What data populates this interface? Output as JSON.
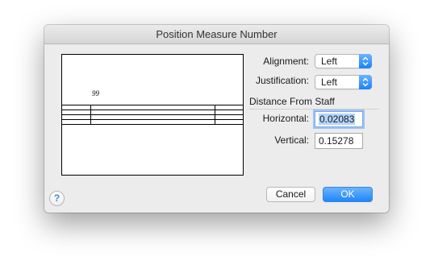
{
  "dialog": {
    "title": "Position Measure Number"
  },
  "preview": {
    "measure_number": "99"
  },
  "alignment": {
    "label": "Alignment:",
    "value": "Left"
  },
  "justification": {
    "label": "Justification:",
    "value": "Left"
  },
  "distance": {
    "section_label": "Distance From Staff",
    "horizontal_label": "Horizontal:",
    "horizontal_value": "0.02083",
    "vertical_label": "Vertical:",
    "vertical_value": "0.15278"
  },
  "buttons": {
    "help": "?",
    "cancel": "Cancel",
    "ok": "OK"
  },
  "colors": {
    "accent": "#1f86fb",
    "selection": "#b4d4fd"
  },
  "icons": {
    "popup": "up-down-chevron-icon",
    "help": "question-mark-icon"
  }
}
